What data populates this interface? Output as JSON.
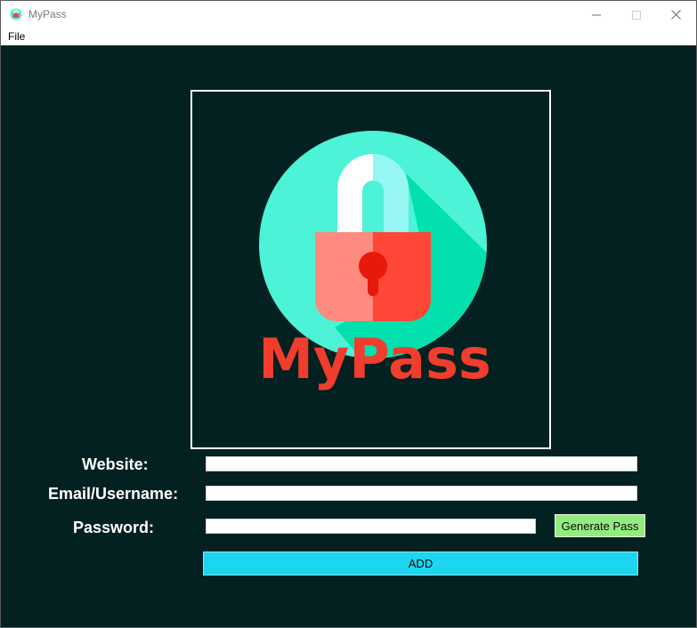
{
  "window": {
    "title": "MyPass"
  },
  "menu": {
    "file_label": "File"
  },
  "logo": {
    "brand_text": "MyPass",
    "colors": {
      "circle": "#4cf3d6",
      "shadow": "#02e0ad",
      "shackle_left": "#ffffff",
      "shackle_right": "#96f6f2",
      "body_left": "#fe8a80",
      "body_right": "#ff4637",
      "keyhole": "#e6190b",
      "text": "#f13d2e"
    }
  },
  "form": {
    "website_label": "Website:",
    "website_value": "",
    "email_label": "Email/Username:",
    "email_value": "",
    "password_label": "Password:",
    "password_value": "",
    "generate_button": "Generate Pass",
    "add_button": "ADD"
  }
}
